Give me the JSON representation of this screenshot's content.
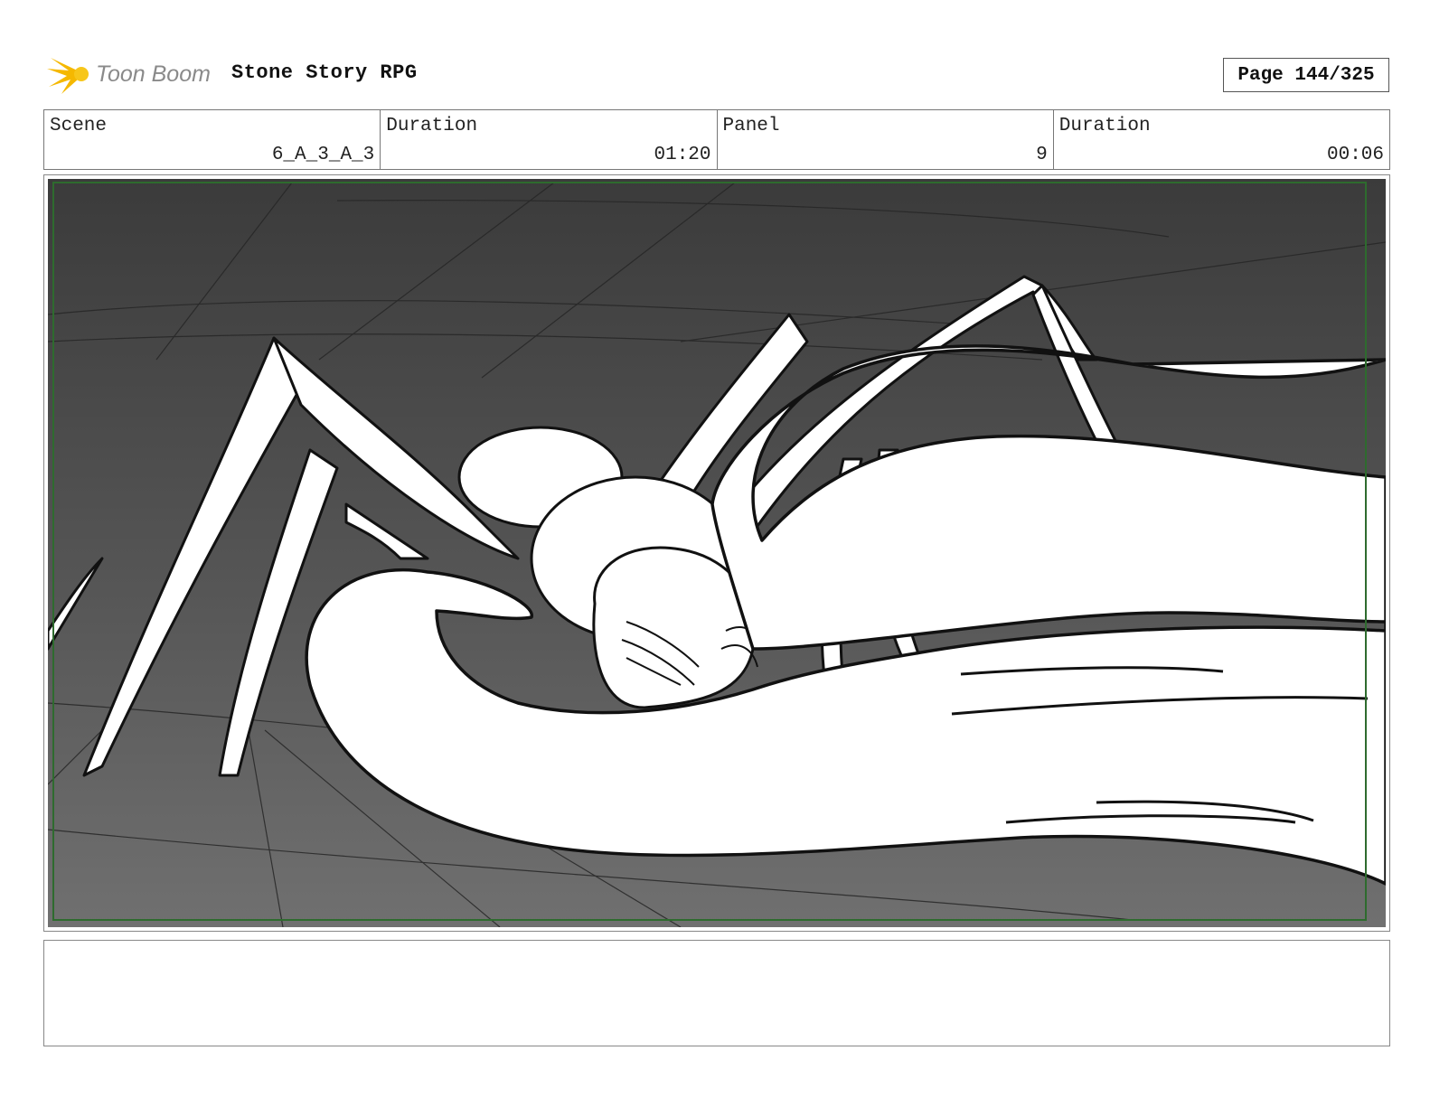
{
  "header": {
    "brand": "Toon Boom",
    "project_title": "Stone Story RPG",
    "page_label": "Page 144/325"
  },
  "info": {
    "scene_label": "Scene",
    "scene_value": "6_A_3_A_3",
    "scene_duration_label": "Duration",
    "scene_duration_value": "01:20",
    "panel_label": "Panel",
    "panel_value": "9",
    "panel_duration_label": "Duration",
    "panel_duration_value": "00:06"
  },
  "colors": {
    "frame_green": "#2e6b2e",
    "logo_yellow": "#f5b800",
    "logo_gray": "#8a8a8a"
  },
  "notes": {
    "text": ""
  }
}
